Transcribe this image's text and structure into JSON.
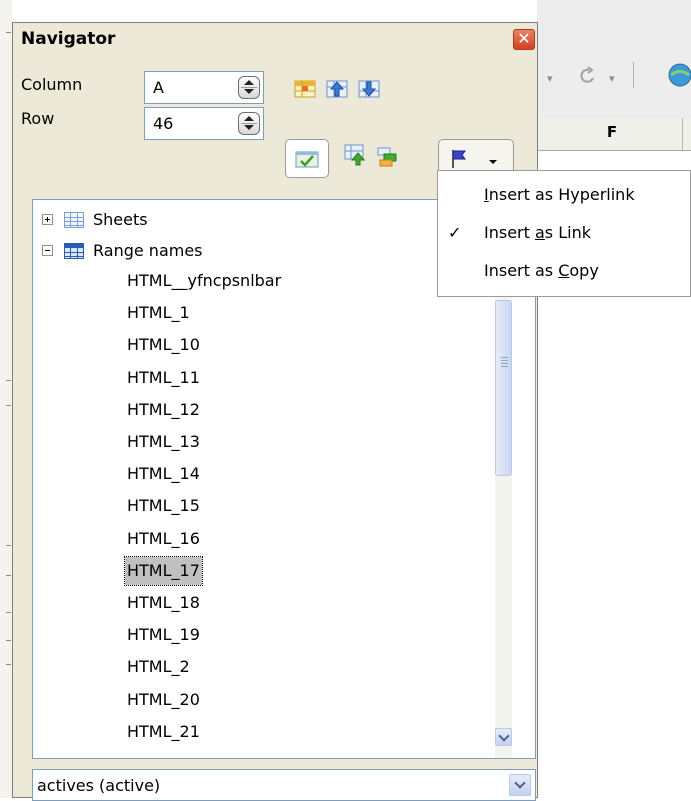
{
  "window": {
    "title": "Navigator",
    "close_icon": "close-icon"
  },
  "controls": {
    "column_label": "Column",
    "column_value": "A",
    "row_label": "Row",
    "row_value": "46"
  },
  "toolbar": {
    "icons": [
      "data-range-icon",
      "start-icon",
      "end-icon",
      "contents-icon",
      "toggle-icon",
      "scenarios-icon",
      "drag-mode-icon"
    ],
    "drag_mode_active": true
  },
  "tree": {
    "categories": [
      {
        "label": "Sheets",
        "expanded": false
      },
      {
        "label": "Range names",
        "expanded": true
      }
    ],
    "items": [
      "HTML__yfncpsnlbar",
      "HTML_1",
      "HTML_10",
      "HTML_11",
      "HTML_12",
      "HTML_13",
      "HTML_14",
      "HTML_15",
      "HTML_16",
      "HTML_17",
      "HTML_18",
      "HTML_19",
      "HTML_2",
      "HTML_20",
      "HTML_21"
    ],
    "selected_item": "HTML_17"
  },
  "document_selector": {
    "value": "actives (active)"
  },
  "drag_mode_menu": {
    "items": [
      {
        "pre": "",
        "mnemonic": "I",
        "post": "nsert as Hyperlink",
        "checked": false
      },
      {
        "pre": "Insert ",
        "mnemonic": "a",
        "post": "s Link",
        "checked": true
      },
      {
        "pre": "Insert as ",
        "mnemonic": "C",
        "post": "opy",
        "checked": false
      }
    ],
    "check_glyph": "✓"
  },
  "background": {
    "column_header": "F"
  },
  "colors": {
    "dialog_bg": "#ece9d8",
    "selection_bg": "#c0c0c0",
    "close_red": "#d0431f",
    "field_border": "#7f9db9"
  }
}
